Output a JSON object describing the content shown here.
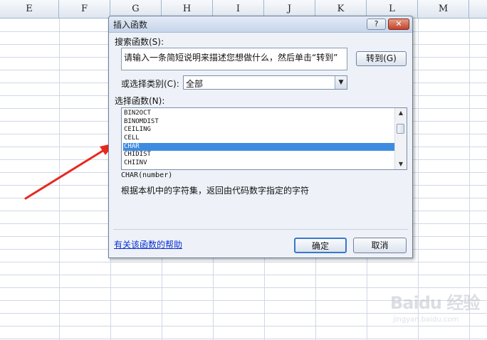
{
  "spreadsheet": {
    "columns": [
      "E",
      "F",
      "G",
      "H",
      "I",
      "J",
      "K",
      "L",
      "M"
    ]
  },
  "dialog": {
    "title": "插入函数",
    "help_button": "?",
    "close_button": "✕",
    "search_label": "搜索函数(S):",
    "search_value": "请输入一条简短说明来描述您想做什么，然后单击“转到”",
    "goto_button": "转到(G)",
    "category_label": "或选择类别(C):",
    "category_value": "全部",
    "function_list_label": "选择函数(N):",
    "functions": [
      "BIN2OCT",
      "BINOMDIST",
      "CEILING",
      "CELL",
      "CHAR",
      "CHIDIST",
      "CHIINV"
    ],
    "selected_function": "CHAR",
    "signature": "CHAR(number)",
    "description": "根据本机中的字符集，返回由代码数字指定的字符",
    "help_link": "有关该函数的帮助",
    "ok_button": "确定",
    "cancel_button": "取消"
  },
  "watermark": {
    "brand": "Baidu 经验",
    "url": "jingyan.baidu.com"
  },
  "colors": {
    "selection": "#3d8be0",
    "annotation_arrow": "#e8281e",
    "link": "#0a2fd0"
  }
}
